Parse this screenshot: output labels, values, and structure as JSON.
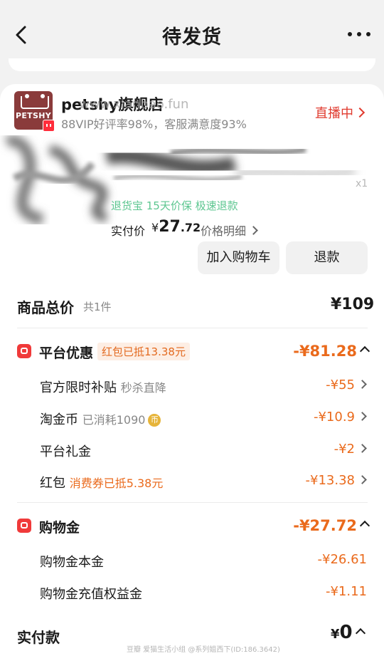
{
  "header": {
    "title": "待发货"
  },
  "shop": {
    "logo_text": "PETSHY",
    "name": "petshy旗舰店",
    "watermark": "www.xianbao.fun",
    "rating": "88VIP好评率98%，客服满意度93%",
    "live_label": "直播中"
  },
  "product": {
    "quantity": "x1",
    "service_tags": "退货宝   15天价保   极速退款",
    "actual_price_label": "实付价",
    "actual_price_currency": "¥",
    "actual_price_int": "27",
    "actual_price_dec": ".72",
    "price_detail": "价格明细",
    "btn_cart": "加入购物车",
    "btn_refund": "退款"
  },
  "total": {
    "label": "商品总价",
    "count": "共1件",
    "value": "¥109"
  },
  "platform": {
    "title": "平台优惠",
    "tag": "红包已抵13.38元",
    "value": "-¥81.28",
    "items": [
      {
        "label": "官方限时补贴",
        "note": "秒杀直降",
        "value": "-¥55"
      },
      {
        "label": "淘金币",
        "note": "已消耗1090",
        "coin": "币",
        "value": "-¥10.9"
      },
      {
        "label": "平台礼金",
        "value": "-¥2"
      },
      {
        "label": "红包",
        "note": "消费券已抵5.38元",
        "value": "-¥13.38"
      }
    ]
  },
  "shopping_gold": {
    "title": "购物金",
    "value": "-¥27.72",
    "items": [
      {
        "label": "购物金本金",
        "value": "-¥26.61"
      },
      {
        "label": "购物金充值权益金",
        "value": "-¥1.11"
      }
    ]
  },
  "final": {
    "label": "实付款",
    "currency": "¥",
    "value": "0"
  },
  "footer_watermark": "豆瓣  爱猫生活小组 @系列姐西下(ID:186.3642)",
  "colors": {
    "accent_red": "#f03a3a",
    "discount_orange": "#ea6a1c",
    "live_red": "#e03a2e",
    "service_green": "#26b36b"
  }
}
